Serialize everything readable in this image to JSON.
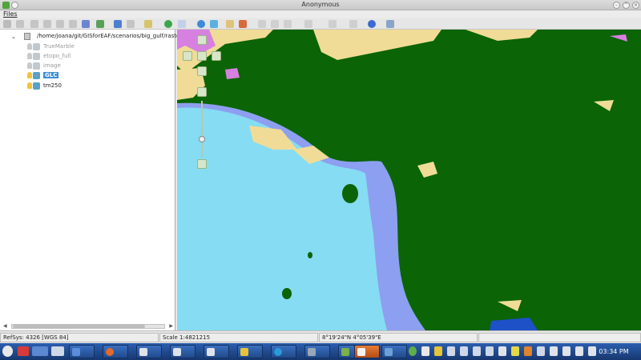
{
  "window": {
    "title": "Anonymous"
  },
  "menu": {
    "files_label": "Files"
  },
  "layers": {
    "root_path": "/home/joana/git/GISforEAF/scenarios/big_gulf/raste",
    "items": [
      {
        "name": "TrueMarble",
        "visible": false
      },
      {
        "name": "etopo_full",
        "visible": false
      },
      {
        "name": "image",
        "visible": false
      },
      {
        "name": "GLC",
        "visible": true,
        "selected": true
      },
      {
        "name": "tm250",
        "visible": true
      }
    ]
  },
  "status": {
    "refsys": "RefSys: 4326 [WGS 84]",
    "scale": "Scale 1:4821215",
    "coordinates": "8°19'24\"N     4°05'39\"E"
  },
  "taskbar": {
    "clock": "03:34 PM"
  },
  "map": {
    "colors": {
      "land_forest": "#0b6406",
      "sea_deep": "#86dcf2",
      "sea_shelf": "#8d9ff0",
      "cropland": "#f0dc96",
      "bare": "#d680e0",
      "water": "#1e50c8"
    }
  }
}
